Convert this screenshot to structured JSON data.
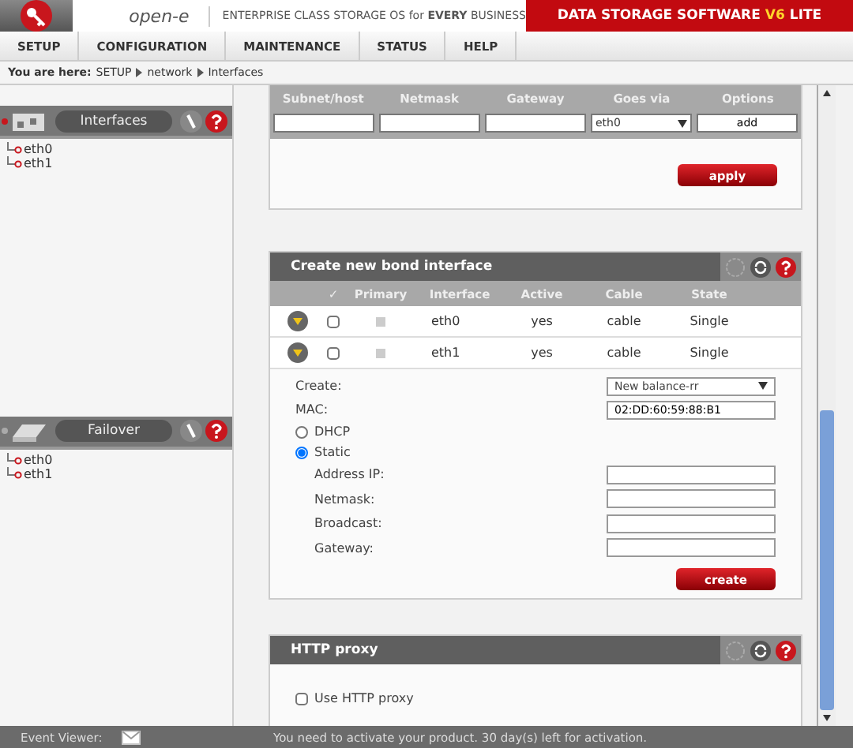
{
  "header": {
    "tagline": "ENTERPRISE CLASS STORAGE OS for **EVERY** BUSINESS",
    "logo_text": "open-e",
    "banner": {
      "before": "DATA STORAGE SOFTWARE",
      "version": "V6",
      "after": "LITE"
    }
  },
  "menu": [
    {
      "label": "SETUP",
      "selected": false
    },
    {
      "label": "CONFIGURATION",
      "selected": false
    },
    {
      "label": "MAINTENANCE",
      "selected": false
    },
    {
      "label": "STATUS",
      "selected": false
    },
    {
      "label": "HELP",
      "selected": false
    }
  ],
  "breadcrumb": {
    "label": "You are here:",
    "items": [
      "SETUP",
      "network",
      "Interfaces"
    ]
  },
  "sidebar": [
    {
      "title": "Interfaces",
      "items": [
        "eth0",
        "eth1"
      ]
    },
    {
      "title": "Failover",
      "items": [
        "eth0",
        "eth1"
      ]
    }
  ],
  "route_panel": {
    "columns": [
      "Subnet/host",
      "Netmask",
      "Gateway",
      "Goes via",
      "Options"
    ],
    "goes_via": "eth0",
    "add": "add",
    "apply": "apply"
  },
  "bond_panel": {
    "title": "Create new bond interface",
    "columns": [
      "✓",
      "Primary",
      "Interface",
      "Active",
      "Cable",
      "State"
    ],
    "rows": [
      {
        "checked": false,
        "interface": "eth0",
        "active": "yes",
        "cable": "cable",
        "state": "Single"
      },
      {
        "checked": false,
        "interface": "eth1",
        "active": "yes",
        "cable": "cable",
        "state": "Single"
      }
    ],
    "create_label": "Create:",
    "create_value": "New balance-rr",
    "mac_label": "MAC:",
    "mac_value": "02:DD:60:59:88:B1",
    "modes": [
      {
        "label": "DHCP",
        "selected": false
      },
      {
        "label": "Static",
        "selected": true
      }
    ],
    "fields": [
      "Address IP:",
      "Netmask:",
      "Broadcast:",
      "Gateway:"
    ],
    "button": "create"
  },
  "proxy_panel": {
    "title": "HTTP proxy",
    "option": {
      "label": "Use HTTP proxy",
      "checked": false
    }
  },
  "status_bar": {
    "event_viewer": "Event Viewer:",
    "message": "You need to activate your product. 30 day(s) left for activation."
  }
}
